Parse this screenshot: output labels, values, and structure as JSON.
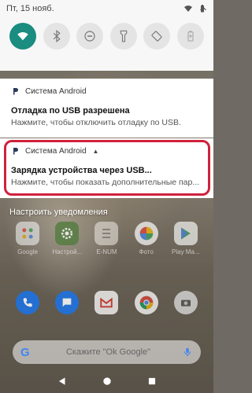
{
  "status_bar": {
    "date": "Пт, 15 нояб."
  },
  "quick_settings": {
    "tiles": [
      {
        "icon": "wifi-icon",
        "active": true
      },
      {
        "icon": "bluetooth-icon",
        "active": false
      },
      {
        "icon": "do-not-disturb-icon",
        "active": false
      },
      {
        "icon": "flashlight-icon",
        "active": false
      },
      {
        "icon": "auto-rotate-icon",
        "active": false
      },
      {
        "icon": "battery-saver-icon",
        "active": false
      }
    ]
  },
  "notifications": [
    {
      "app": "Система Android",
      "title": "Отладка по USB разрешена",
      "text": "Нажмите, чтобы отключить отладку по USB."
    },
    {
      "app": "Система Android",
      "title": "Зарядка устройства через USB...",
      "text": "Нажмите, чтобы показать дополнительные пар..."
    }
  ],
  "manage_notifications": "Настроить уведомления",
  "home_apps": {
    "row1": [
      {
        "label": "Google",
        "color": "#f1f1f1",
        "icon": "google-folder-icon"
      },
      {
        "label": "Настрой...",
        "color": "#4d7a3a",
        "icon": "settings-icon"
      },
      {
        "label": "E-NUM",
        "color": "#e7e2dc",
        "icon": "enum-icon"
      },
      {
        "label": "Фото",
        "color": "#ffffff",
        "icon": "photos-icon"
      },
      {
        "label": "Play Ма...",
        "color": "#ffffff",
        "icon": "play-store-icon"
      }
    ],
    "row2": [
      {
        "icon": "phone-icon",
        "color": "#1a73e8"
      },
      {
        "icon": "messages-icon",
        "color": "#1a73e8"
      },
      {
        "icon": "gmail-icon",
        "color": "#ffffff"
      },
      {
        "icon": "chrome-icon",
        "color": "#ffffff"
      },
      {
        "icon": "camera-icon",
        "color": "#e0e0e0"
      }
    ]
  },
  "search": {
    "placeholder": "Скажите \"Ok Google\""
  },
  "colors": {
    "accent": "#1a8c80",
    "highlight": "#d0213c"
  }
}
